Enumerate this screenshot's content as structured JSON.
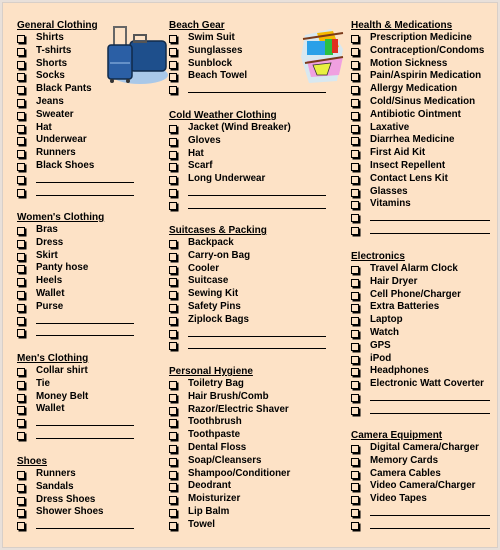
{
  "columns": [
    {
      "sections": [
        {
          "title": "General Clothing",
          "items": [
            "Shirts",
            "T-shirts",
            "Shorts",
            "Socks",
            "Black Pants",
            "Jeans",
            "Sweater",
            "Hat",
            "Underwear",
            "Runners",
            "Black Shoes",
            "",
            ""
          ]
        },
        {
          "title": "Women's Clothing",
          "items": [
            "Bras",
            "Dress",
            "Skirt",
            "Panty hose",
            "Heels",
            "Wallet",
            "Purse",
            "",
            ""
          ]
        },
        {
          "title": "Men's Clothing",
          "items": [
            "Collar shirt",
            "Tie",
            "Money Belt",
            "Wallet",
            "",
            ""
          ]
        },
        {
          "title": "Shoes",
          "items": [
            "Runners",
            "Sandals",
            "Dress Shoes",
            "Shower Shoes",
            ""
          ]
        }
      ]
    },
    {
      "sections": [
        {
          "title": "Beach Gear",
          "items": [
            "Swim Suit",
            "Sunglasses",
            "Sunblock",
            "Beach Towel",
            ""
          ]
        },
        {
          "title": "Cold Weather Clothing",
          "items": [
            "Jacket (Wind Breaker)",
            "Gloves",
            "Hat",
            "Scarf",
            "Long Underwear",
            "",
            ""
          ]
        },
        {
          "title": "Suitcases & Packing",
          "items": [
            "Backpack",
            "Carry-on Bag",
            "Cooler",
            "Suitcase",
            "Sewing Kit",
            "Safety Pins",
            "Ziplock Bags",
            "",
            ""
          ]
        },
        {
          "title": "Personal Hygiene",
          "items": [
            "Toiletry Bag",
            "Hair Brush/Comb",
            "Razor/Electric Shaver",
            "Toothbrush",
            "Toothpaste",
            "Dental Floss",
            "Soap/Cleansers",
            "Shampoo/Conditioner",
            "Deodrant",
            "Moisturizer",
            "Lip Balm",
            "Towel"
          ]
        }
      ]
    },
    {
      "sections": [
        {
          "title": "Health & Medications",
          "items": [
            "Prescription Medicine",
            "Contraception/Condoms",
            "Motion Sickness",
            "Pain/Aspirin Medication",
            "Allergy Medication",
            "Cold/Sinus Medication",
            "Antibiotic Ointment",
            "Laxative",
            "Diarrhea Medicine",
            "First Aid Kit",
            "Insect Repellent",
            "Contact Lens Kit",
            "Glasses",
            "Vitamins",
            "",
            ""
          ]
        },
        {
          "title": "Electronics",
          "items": [
            "Travel Alarm Clock",
            "Hair Dryer",
            "Cell Phone/Charger",
            "Extra Batteries",
            "Laptop",
            "Watch",
            "GPS",
            "iPod",
            "Headphones",
            "Electronic Watt Coverter",
            "",
            ""
          ]
        },
        {
          "title": "Camera Equipment",
          "items": [
            "Digital Camera/Charger",
            "Memory Cards",
            "Camera Cables",
            "Video Camera/Charger",
            "Video Tapes",
            "",
            ""
          ]
        }
      ]
    }
  ],
  "images": {
    "suitcase": "suitcase-clipart",
    "clothes": "clothesline-clipart"
  },
  "colors": {
    "background": "#fde2c6"
  }
}
